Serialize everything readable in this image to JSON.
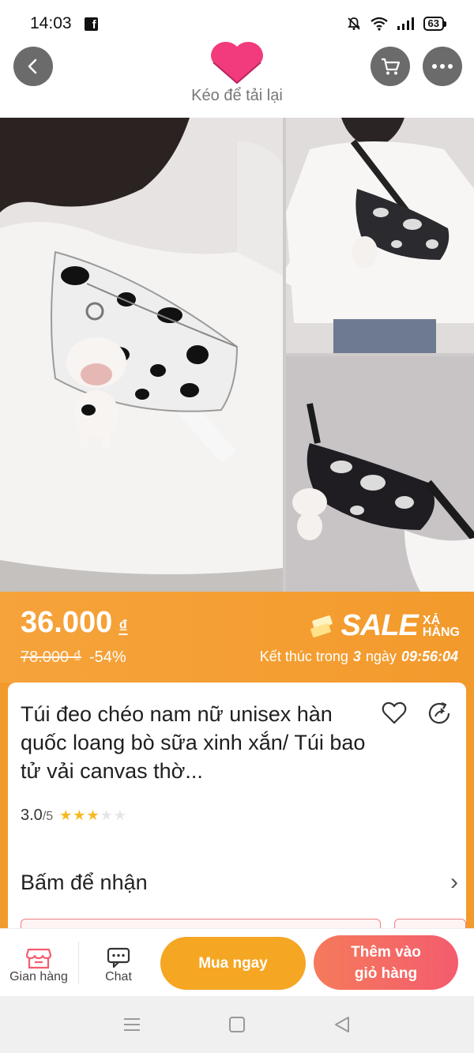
{
  "status_bar": {
    "time": "14:03",
    "battery": "63"
  },
  "header": {
    "reload_hint": "Kéo để tải lại"
  },
  "flash_sale": {
    "price": "36.000",
    "currency": "₫",
    "old_price": "78.000 ₫",
    "discount": "-54%",
    "sale_word": "SALE",
    "sale_suffix_1": "XẢ",
    "sale_suffix_2": "HÀNG",
    "ends_prefix": "Kết thúc trong",
    "days": "3",
    "days_unit": "ngày",
    "countdown": "09:56:04"
  },
  "product": {
    "title": "Túi đeo chéo nam nữ unisex hàn quốc loang bò sữa xinh xắn/ Túi bao tử vải canvas thờ...",
    "rating": "3.0",
    "rating_max": "/5",
    "stars_filled": 3,
    "stars_total": 5
  },
  "voucher_row": {
    "label": "Bấm để nhận"
  },
  "action_bar": {
    "shop_label": "Gian hàng",
    "chat_label": "Chat",
    "buy_now": "Mua ngay",
    "add_to_cart_line1": "Thêm vào",
    "add_to_cart_line2": "giỏ hàng"
  },
  "colors": {
    "accent_orange": "#f39a2c",
    "cart_gradient": "#f45c6d",
    "star": "#f7b924"
  }
}
